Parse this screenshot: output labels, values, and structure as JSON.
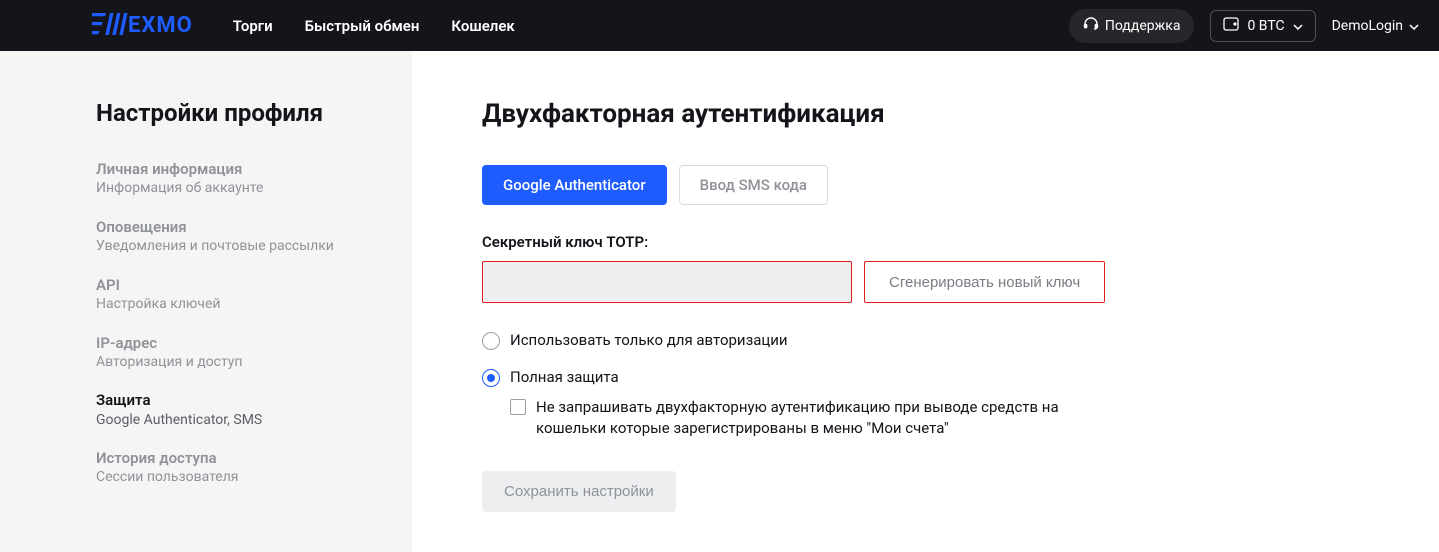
{
  "header": {
    "logo_text": "EXMO",
    "nav": [
      "Торги",
      "Быстрый обмен",
      "Кошелек"
    ],
    "support_label": "Поддержка",
    "balance_label": "0 BTC",
    "user_label": "DemoLogin"
  },
  "sidebar": {
    "title": "Настройки профиля",
    "items": [
      {
        "title": "Личная информация",
        "sub": "Информация об аккаунте"
      },
      {
        "title": "Оповещения",
        "sub": "Уведомления и почтовые рассылки"
      },
      {
        "title": "API",
        "sub": "Настройка ключей"
      },
      {
        "title": "IP-адрес",
        "sub": "Авторизация и доступ"
      },
      {
        "title": "Защита",
        "sub": "Google Authenticator, SMS"
      },
      {
        "title": "История доступа",
        "sub": "Сессии пользователя"
      }
    ]
  },
  "main": {
    "title": "Двухфакторная аутентификация",
    "tabs": [
      "Google Authenticator",
      "Ввод SMS кода"
    ],
    "secret_label": "Секретный ключ TOTP:",
    "secret_value": "",
    "generate_label": "Сгенерировать новый ключ",
    "radio_auth_only": "Использовать только для авторизации",
    "radio_full": "Полная защита",
    "checkbox_skip": "Не запрашивать двухфакторную аутентификацию при выводе средств на кошельки которые зарегистрированы в меню \"Мои счета\"",
    "save_label": "Сохранить настройки"
  }
}
